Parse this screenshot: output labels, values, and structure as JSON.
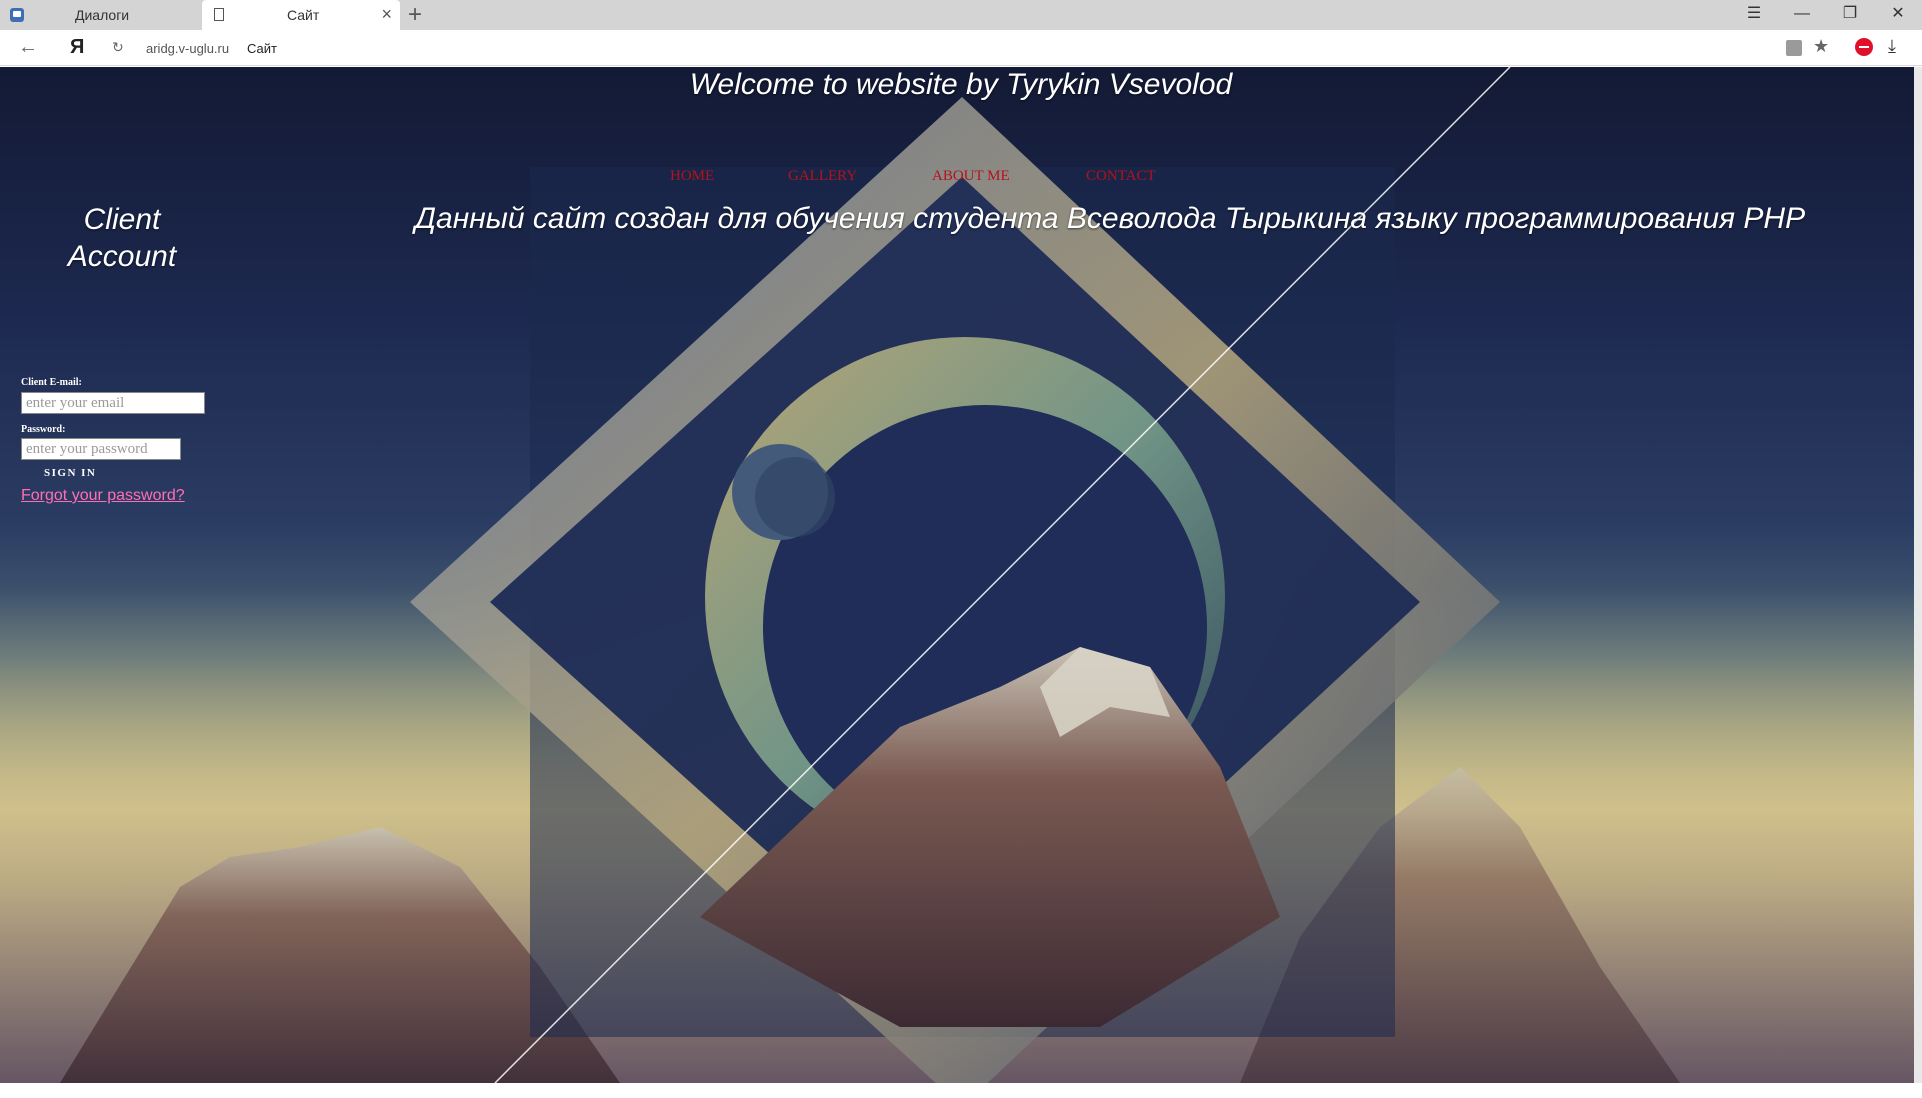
{
  "browser": {
    "tabs": [
      {
        "title": "Диалоги",
        "active": false,
        "icon": "chat-app-icon"
      },
      {
        "title": "Сайт",
        "active": true,
        "icon": "page-icon"
      }
    ],
    "address": {
      "domain": "aridg.v-uglu.ru",
      "page_title": "Сайт"
    },
    "icons": {
      "back": "←",
      "yandex": "Я",
      "reload": "↻",
      "bookmark": "★",
      "download": "⤓",
      "menu": "☰",
      "minimize": "—",
      "restore": "❐",
      "close": "✕",
      "new_tab": "+",
      "tab_close": "×"
    }
  },
  "page": {
    "title": "Welcome to website by Tyrykin Vsevolod",
    "nav": [
      "HOME",
      "GALLERY",
      "ABOUT ME",
      "CONTACT"
    ],
    "welcome": "Данный сайт создан для обучения студента Всеволода Тырыкина языку программирования PHP",
    "login": {
      "heading": "Client Account",
      "email_label": "Client E-mail:",
      "email_placeholder": "enter your email",
      "password_label": "Password:",
      "password_placeholder": "enter your password",
      "signin": "SIGN IN",
      "forgot": "Forgot your password?"
    },
    "colors": {
      "nav_link": "#b4121c",
      "forgot_link": "#ff6fb4",
      "heading_text": "#ffffff"
    }
  }
}
